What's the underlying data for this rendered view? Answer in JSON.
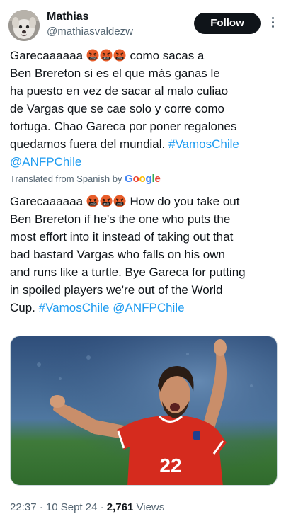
{
  "author": {
    "name": "Mathias",
    "handle": "@mathiasvaldezw",
    "avatar_icon": "dog-avatar-icon"
  },
  "follow_label": "Follow",
  "more_icon": "more-vertical-icon",
  "emoji": "angry-swearing-face",
  "original": {
    "l1_pre": "Garecaaaaaa",
    "l1_post": " como sacas a",
    "l2": "Ben Brereton si es el que más ganas le",
    "l3": "ha puesto en vez de sacar al malo culiao",
    "l4": "de Vargas que se cae solo y corre como",
    "l5": "tortuga. Chao Gareca por poner regalones",
    "l6_text": "quedamos fuera del mundial. ",
    "l6_tag": "#VamosChile",
    "l7_mention": "@ANFPChile"
  },
  "translated_by": {
    "label": "Translated from Spanish by ",
    "google": [
      "G",
      "o",
      "o",
      "g",
      "l",
      "e"
    ]
  },
  "translation": {
    "l1_pre": "Garecaaaaaa",
    "l1_post": " How do you take out",
    "l2": "Ben Brereton if he's the one who puts the",
    "l3": "most effort into it instead of taking out that",
    "l4": "bad bastard Vargas who falls on his own",
    "l5": "and runs like a turtle. Bye Gareca for putting",
    "l6": "in spoiled players we're out of the World",
    "l7_text": "Cup. ",
    "l7_tag": "#VamosChile",
    "l7_space": " ",
    "l7_mention": "@ANFPChile"
  },
  "media": {
    "jersey_number": "22",
    "colors": {
      "shirt": "#d52b1e",
      "sleeve_trim": "#1f3f8f",
      "pitch": "#3e7a35",
      "stands": "#3c5d8a"
    }
  },
  "meta": {
    "time": "22:37",
    "sep1": " · ",
    "date": "10 Sept 24",
    "sep2": " · ",
    "views_count": "2,761",
    "views_label": " Views"
  },
  "colors": {
    "link": "#1d9bf0",
    "secondary": "#536471",
    "text": "#0f1419"
  }
}
